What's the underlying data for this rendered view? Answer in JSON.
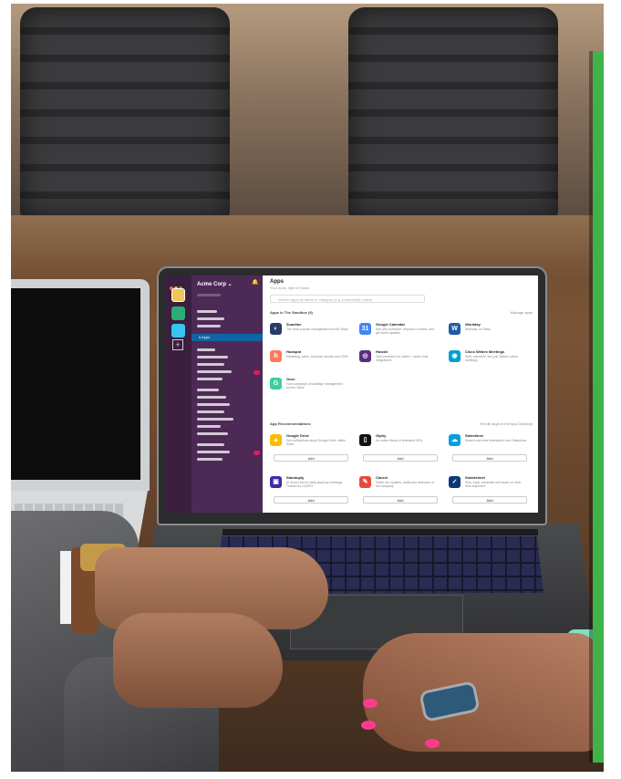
{
  "scene": {
    "description_elements": [
      "photo",
      "laptop-screen",
      "hands"
    ]
  },
  "screen": {
    "workspace_name": "Acme Corp ⌄",
    "bell_icon": "bell-icon",
    "active_channel": "# Apps",
    "main": {
      "title": "Apps",
      "subtitle": "Your tools, right in Slack",
      "search_placeholder": "Search apps by name or category (e.g. productivity, sales)",
      "section_installed": "Apps in The Sandbox (9)",
      "section_installed_link": "Manage apps",
      "section_recommended": "App Recommendations",
      "section_recommended_link": "See all apps in the App Directory",
      "installed_apps": [
        {
          "name": "Scanline",
          "desc": "The most popular management tool for Slack",
          "icon_text": "◐",
          "color": "#2d3b6b"
        },
        {
          "name": "Google Calendar",
          "desc": "See your schedule, respond to invites, and get event updates",
          "icon_text": "31",
          "color": "#4285f4"
        },
        {
          "name": "Workday",
          "desc": "Workday, on Slack",
          "icon_text": "W",
          "color": "#1f5ba8"
        },
        {
          "name": "Hubspot",
          "desc": "Marketing, sales, customer service and CRM",
          "icon_text": "h",
          "color": "#ff7a59"
        },
        {
          "name": "Howzit",
          "desc": "Get connected for coffee + useful chat integrations",
          "icon_text": "◎",
          "color": "#5a2d82"
        },
        {
          "name": "Cisco Webex Meetings",
          "desc": "Start, schedule, and join Webex online meetings",
          "icon_text": "◉",
          "color": "#00a0d1"
        },
        {
          "name": "Guru",
          "desc": "Your company's knowledge management tool for Slack",
          "icon_text": "G",
          "color": "#3ccea0"
        }
      ],
      "recommended_apps": [
        {
          "name": "Google Drive",
          "desc": "Get notifications about Google Drive, within Slack",
          "icon_text": "▲",
          "color": "#fbbc04",
          "add": "Add"
        },
        {
          "name": "Giphy",
          "desc": "An online library of animated GIFs",
          "icon_text": "▯",
          "color": "#111111",
          "add": "Add"
        },
        {
          "name": "Salesforce",
          "desc": "Search and view information from Salesforce",
          "icon_text": "☁",
          "color": "#00a1e0",
          "add": "Add"
        },
        {
          "name": "Standuply",
          "desc": "AI Scrum bot for daily stand-up meetings. Trusted by 10,000+",
          "icon_text": "▣",
          "color": "#3b2ea8",
          "add": "Add"
        },
        {
          "name": "Cancel",
          "desc": "Share live updates, drafts and decisions of the company",
          "icon_text": "✎",
          "color": "#e8493f",
          "add": "Add"
        },
        {
          "name": "Smartsheet",
          "desc": "Plan, track, automate and report on work from anywhere",
          "icon_text": "✓",
          "color": "#0b3b73",
          "add": "Add"
        }
      ]
    }
  },
  "colors": {
    "green_edge": "#3fb34a",
    "rail": "#3b1e40",
    "sidebar": "#4d2a55",
    "active": "#1164a3"
  }
}
